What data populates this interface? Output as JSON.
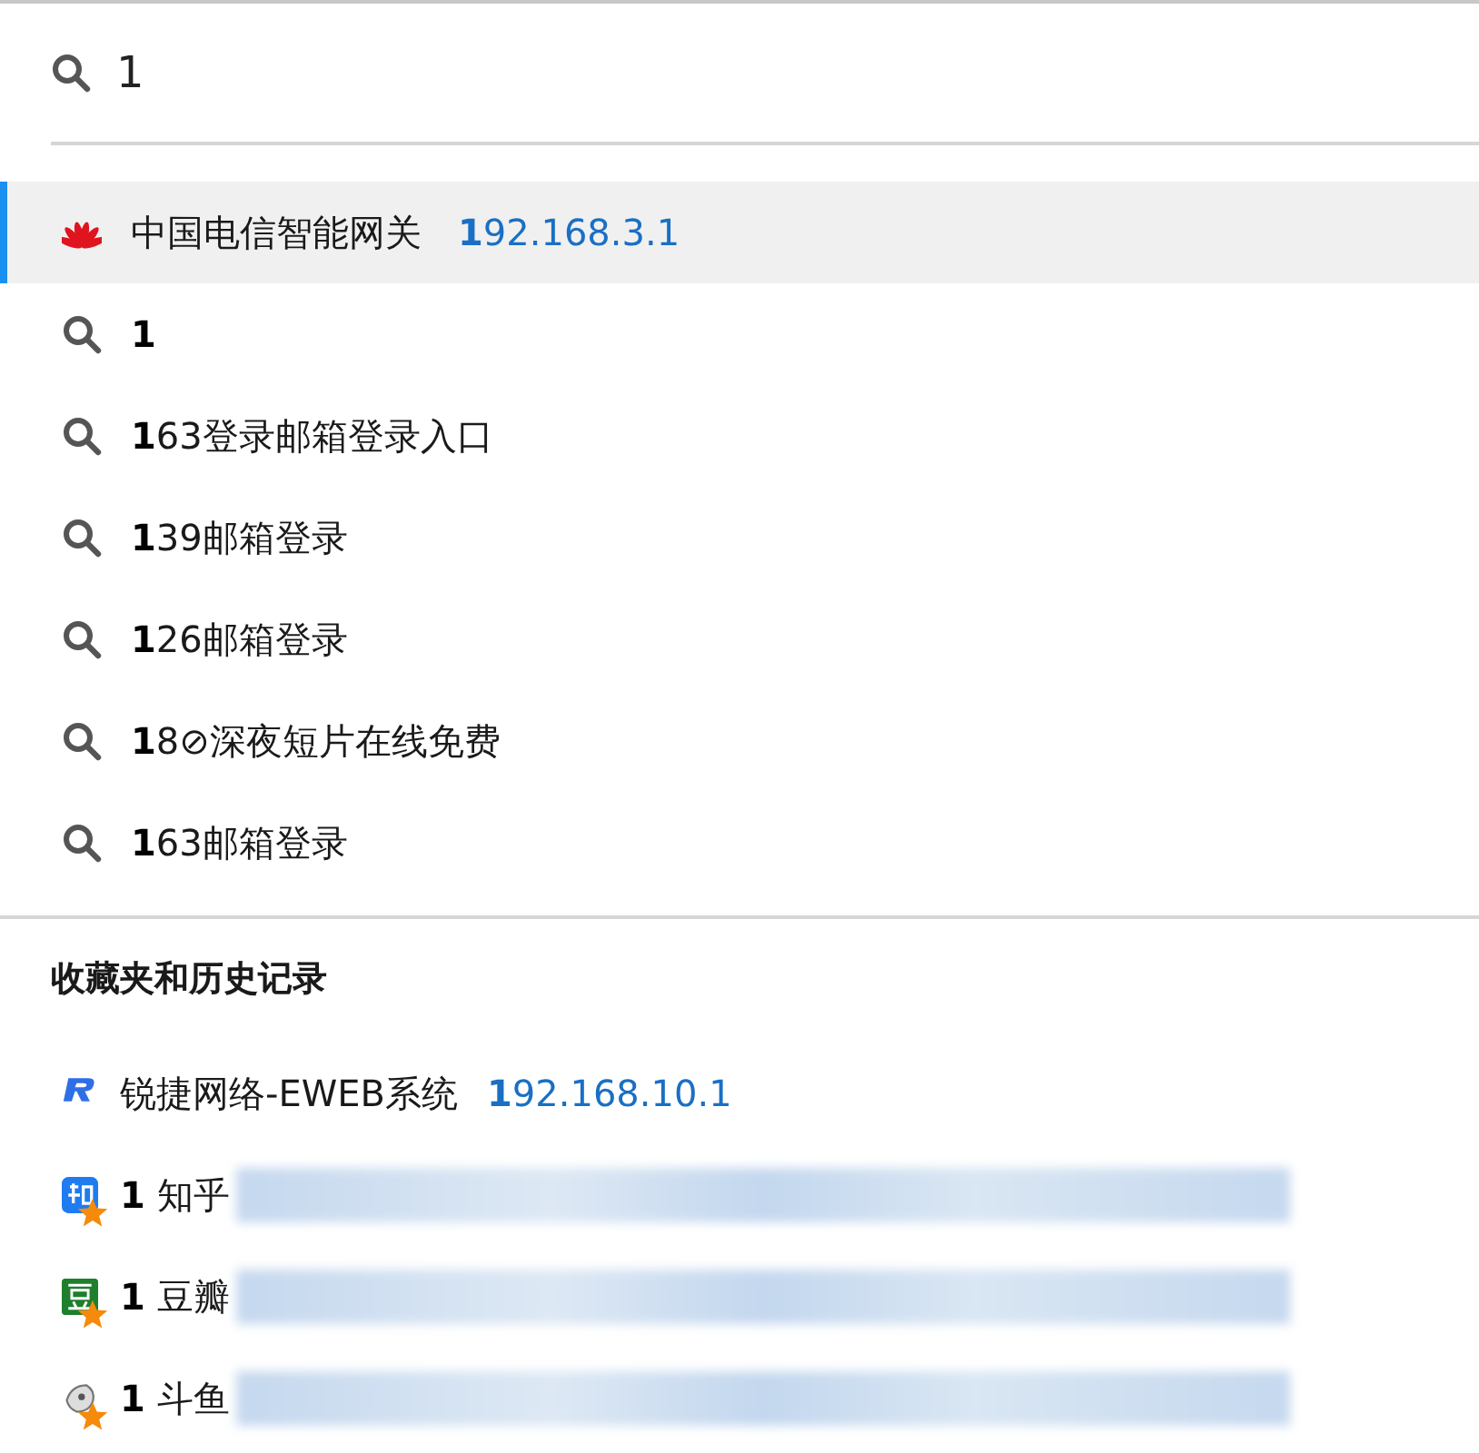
{
  "search": {
    "value": "1"
  },
  "suggestions": [
    {
      "kind": "site",
      "title": "中国电信智能网关",
      "url": "**1**92.168.3.1",
      "selected": true
    },
    {
      "kind": "query",
      "title": "**1**",
      "selected": false
    },
    {
      "kind": "query",
      "title": "**1**63登录邮箱登录入口",
      "selected": false
    },
    {
      "kind": "query",
      "title": "**1**39邮箱登录",
      "selected": false
    },
    {
      "kind": "query",
      "title": "**1**26邮箱登录",
      "selected": false
    },
    {
      "kind": "query",
      "title": "**1**8⊘深夜短片在线免费",
      "selected": false
    },
    {
      "kind": "query",
      "title": "**1**63邮箱登录",
      "selected": false
    }
  ],
  "history": {
    "heading": "收藏夹和历史记录",
    "items": [
      {
        "kind": "r-logo",
        "title": "锐捷网络-EWEB系统",
        "url": "**1**92.168.10.1",
        "starred": false,
        "redacted": false
      },
      {
        "kind": "zhi",
        "title": "**1** 知乎",
        "starred": true,
        "redacted": true
      },
      {
        "kind": "dou",
        "title": "**1** 豆瓣",
        "starred": true,
        "redacted": true
      },
      {
        "kind": "fish",
        "title": "**1** 斗鱼",
        "starred": true,
        "redacted": true
      }
    ]
  }
}
